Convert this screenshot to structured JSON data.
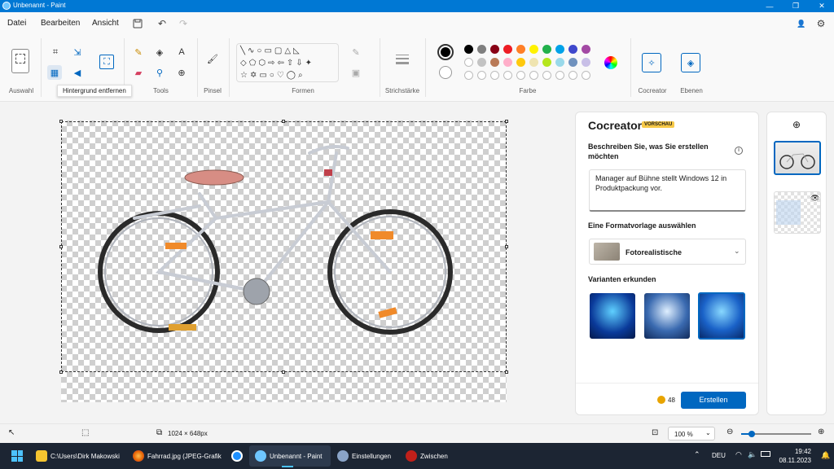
{
  "window": {
    "title": "Unbenannt - Paint"
  },
  "menu": {
    "file": "Datei",
    "edit": "Bearbeiten",
    "view": "Ansicht"
  },
  "ribbon": {
    "groups": {
      "selection": "Auswahl",
      "tools": "Tools",
      "brushes": "Pinsel",
      "shapes": "Formen",
      "stroke": "Strichstärke",
      "colors": "Farbe",
      "cocreator": "Cocreator",
      "layers": "Ebenen"
    },
    "tooltip": "Hintergrund entfernen",
    "palette_row1": [
      "#000000",
      "#7f7f7f",
      "#880015",
      "#ed1c24",
      "#ff7f27",
      "#fff200",
      "#22b14c",
      "#00a2e8",
      "#3f48cc",
      "#a349a4"
    ],
    "palette_row2": [
      "#ffffff",
      "#c3c3c3",
      "#b97a57",
      "#ffaec9",
      "#ffc90e",
      "#efe4b0",
      "#b5e61d",
      "#99d9ea",
      "#7092be",
      "#c8bfe7"
    ]
  },
  "cocreator": {
    "title": "Cocreator",
    "badge": "VORSCHAU",
    "describe_label": "Beschreiben Sie, was Sie erstellen möchten",
    "prompt": "Manager auf Bühne stellt Windows 12 in Produktpackung vor.",
    "style_label": "Eine Formatvorlage auswählen",
    "style_value": "Fotorealistische",
    "variants_label": "Varianten erkunden",
    "credits": "48",
    "create_button": "Erstellen"
  },
  "status": {
    "dimensions": "1024 × 648px",
    "zoom": "100 %"
  },
  "taskbar": {
    "explorer": "C:\\Users\\Dirk Makowski",
    "firefox": "Fahrrad.jpg (JPEG-Grafik",
    "paint": "Unbenannt - Paint",
    "settings": "Einstellungen",
    "clipboard": "Zwischen",
    "lang": "DEU",
    "time": "19:42",
    "date": "08.11.2023"
  }
}
